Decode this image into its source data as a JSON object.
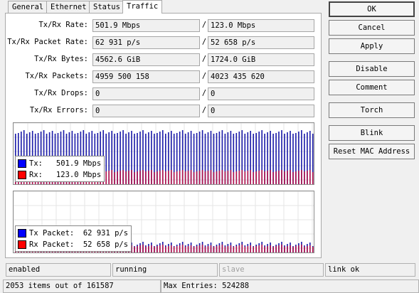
{
  "tabs": [
    "General",
    "Ethernet",
    "Status",
    "Traffic"
  ],
  "fields": [
    {
      "label": "Tx/Rx Rate:",
      "tx": "501.9 Mbps",
      "rx": "123.0 Mbps"
    },
    {
      "label": "Tx/Rx Packet Rate:",
      "tx": "62 931 p/s",
      "rx": "52 658 p/s"
    },
    {
      "label": "Tx/Rx Bytes:",
      "tx": "4562.6 GiB",
      "rx": "1724.0 GiB"
    },
    {
      "label": "Tx/Rx Packets:",
      "tx": "4959 500 158",
      "rx": "4023 435 620"
    },
    {
      "label": "Tx/Rx Drops:",
      "tx": "0",
      "rx": "0"
    },
    {
      "label": "Tx/Rx Errors:",
      "tx": "0",
      "rx": "0"
    }
  ],
  "separator": "/",
  "traffic_legend": {
    "tx": "Tx:   501.9 Mbps",
    "rx": "Rx:   123.0 Mbps"
  },
  "packet_legend": {
    "tx": "Tx Packet:  62 931 p/s",
    "rx": "Rx Packet:  52 658 p/s"
  },
  "buttons": [
    "OK",
    "Cancel",
    "Apply",
    "Disable",
    "Comment",
    "Torch",
    "Blink",
    "Reset MAC Address"
  ],
  "status": {
    "state": "enabled",
    "run": "running",
    "slave": "slave",
    "link": "link ok"
  },
  "footer": {
    "items": "2053 items out of 161587",
    "max": "Max Entries: 524288"
  },
  "colors": {
    "tx": "#1a1aa8",
    "rx": "#b0104a",
    "tx_swatch": "#0000ff",
    "rx_swatch": "#ff0000"
  },
  "chart_data": [
    {
      "type": "bar",
      "name": "traffic",
      "series": [
        {
          "name": "Tx",
          "level": 0.85,
          "unit": "Mbps"
        },
        {
          "name": "Rx",
          "level": 0.22,
          "unit": "Mbps"
        }
      ],
      "bars": 106
    },
    {
      "type": "bar",
      "name": "packets",
      "series": [
        {
          "name": "Tx Packet",
          "level": 0.14
        },
        {
          "name": "Rx Packet",
          "level": 0.11
        }
      ],
      "bars": 106
    }
  ]
}
